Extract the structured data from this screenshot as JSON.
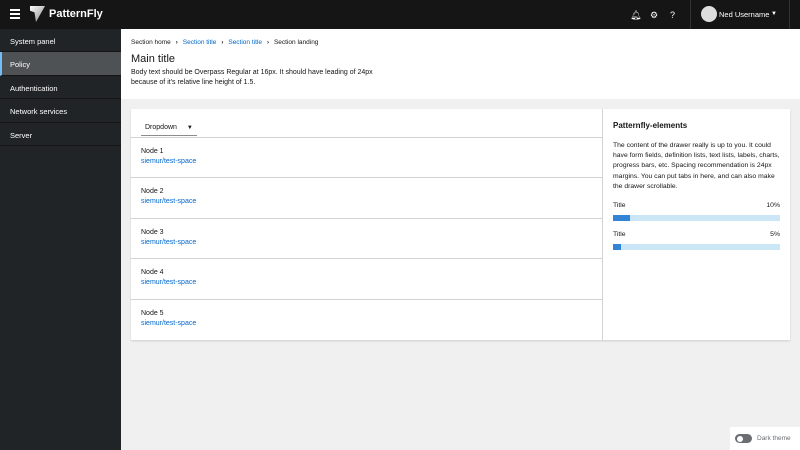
{
  "header": {
    "brand": "PatternFly",
    "user": "Ned Username",
    "icons": [
      "bell-icon",
      "gear-icon",
      "help-icon"
    ]
  },
  "sidebar": {
    "items": [
      {
        "label": "System panel"
      },
      {
        "label": "Policy",
        "active": true
      },
      {
        "label": "Authentication"
      },
      {
        "label": "Network services"
      },
      {
        "label": "Server"
      }
    ]
  },
  "breadcrumb": [
    "Section home",
    "Section title",
    "Section title",
    "Section landing"
  ],
  "page": {
    "title": "Main title",
    "body": "Body text should be Overpass Regular at 16px. It should have leading of 24px because of it's relative line height of 1.5."
  },
  "toolbar": {
    "dropdown": "Dropdown"
  },
  "nodes": [
    {
      "name": "Node 1",
      "link": "siemur/test-space"
    },
    {
      "name": "Node 2",
      "link": "siemur/test-space"
    },
    {
      "name": "Node 3",
      "link": "siemur/test-space"
    },
    {
      "name": "Node 4",
      "link": "siemur/test-space"
    },
    {
      "name": "Node 5",
      "link": "siemur/test-space"
    }
  ],
  "drawer": {
    "title": "Patternfly-elements",
    "text": "The content of the drawer really is up to you. It could have form fields, definition lists, text lists, labels, charts, progress bars, etc. Spacing recommendation is 24px margins. You can put tabs in here, and can also make the drawer scrollable.",
    "progress": [
      {
        "title": "Title",
        "value": 10,
        "label": "10%"
      },
      {
        "title": "Title",
        "value": 5,
        "label": "5%"
      }
    ]
  },
  "theme": {
    "label": "Dark theme",
    "on": false
  },
  "colors": {
    "accent": "#0066cc",
    "header": "#151515",
    "sidebar": "#212427"
  }
}
